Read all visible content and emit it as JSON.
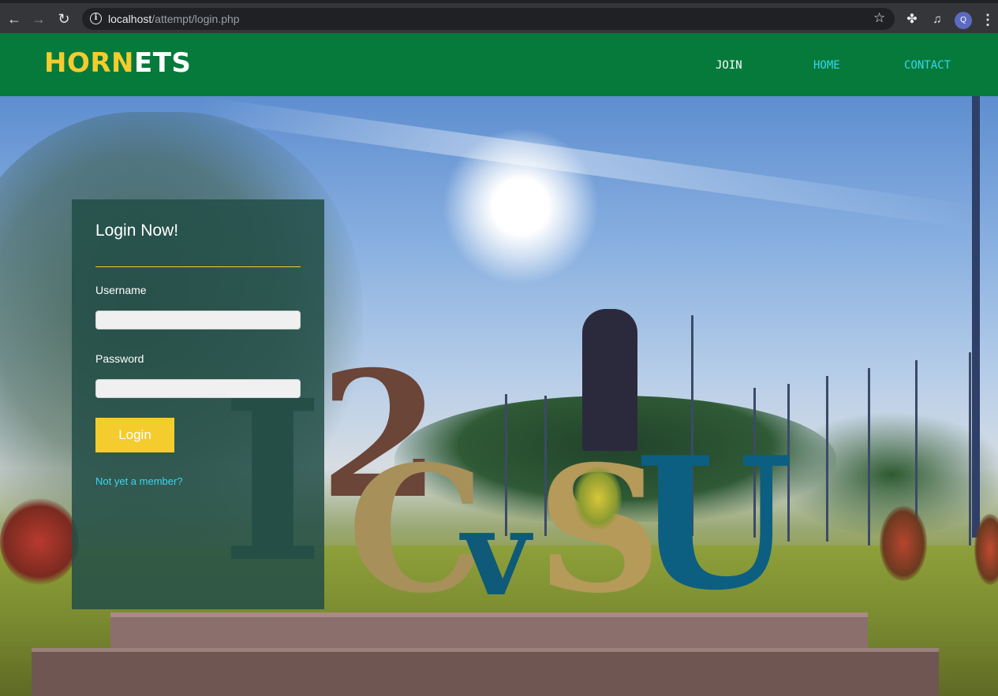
{
  "browser": {
    "url_host": "localhost",
    "url_path": "/attempt/login.php",
    "profile_initial": "Q"
  },
  "site": {
    "logo_part1": "HORN",
    "logo_part2": "ETS",
    "nav": [
      {
        "label": "JOIN"
      },
      {
        "label": "HOME"
      },
      {
        "label": "CONTACT"
      }
    ]
  },
  "login": {
    "title": "Login Now!",
    "username_label": "Username",
    "username_value": "",
    "password_label": "Password",
    "password_value": "",
    "button_label": "Login",
    "signup_link": "Not yet a member?"
  },
  "colors": {
    "header_green": "#067a3b",
    "accent_yellow": "#f4cc2e",
    "link_cyan": "#37d6f0",
    "panel_bg": "#224e46"
  },
  "background": {
    "signage_letters": [
      "I",
      "2",
      "C",
      "v",
      "S",
      "U"
    ]
  }
}
